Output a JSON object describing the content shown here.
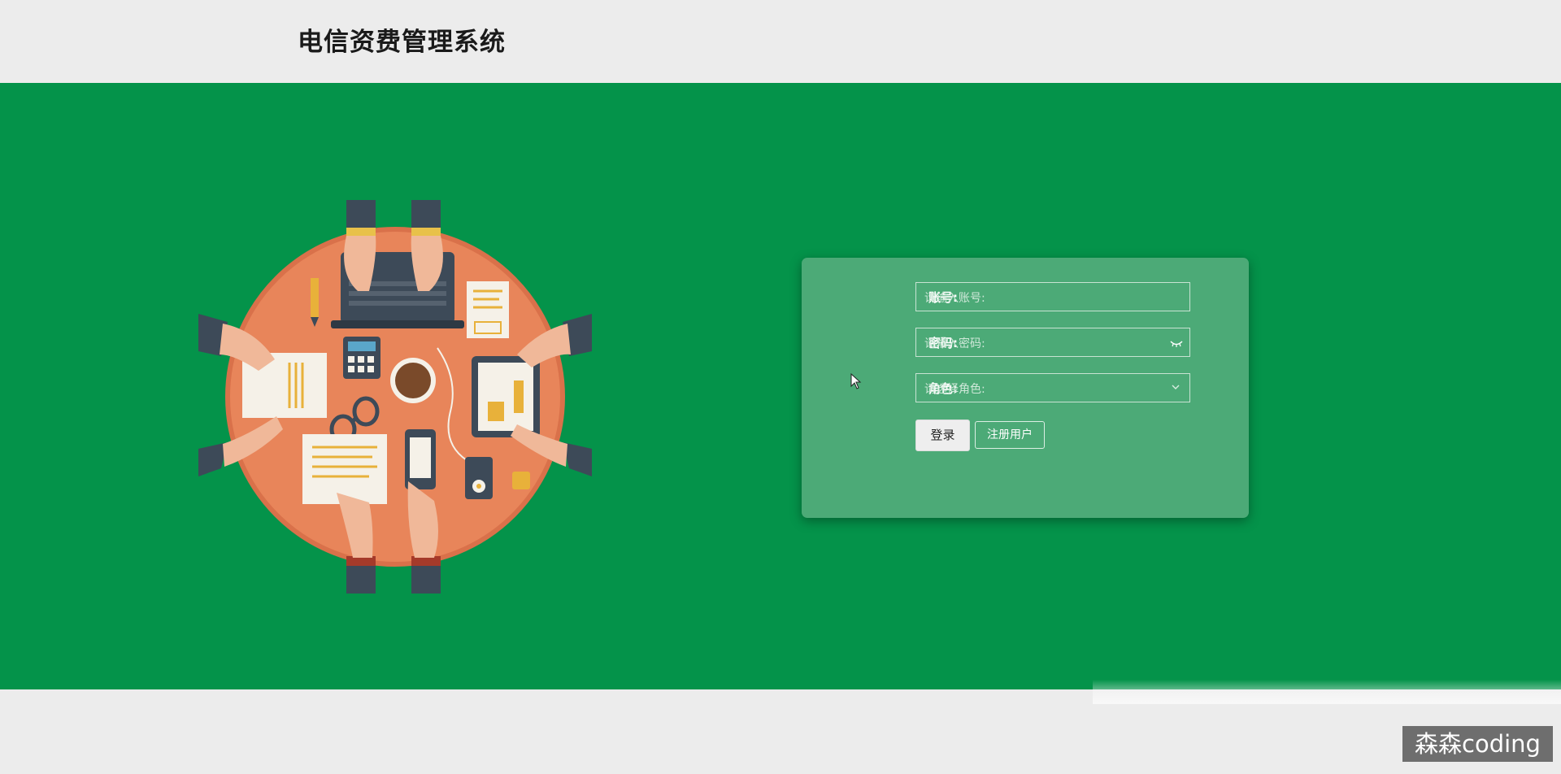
{
  "header": {
    "title": "电信资费管理系统"
  },
  "login": {
    "account_label": "账号:",
    "account_placeholder": "请输入账号:",
    "password_label": "密码:",
    "password_placeholder": "请输入密码:",
    "role_label": "角色:",
    "role_placeholder": "请选择角色:",
    "login_button": "登录",
    "register_button": "注册用户"
  },
  "watermark": "森森coding",
  "colors": {
    "hero_bg": "#04934a",
    "card_bg": "#4caa77",
    "header_bg": "#ececec",
    "table_orange": "#e8855a"
  }
}
